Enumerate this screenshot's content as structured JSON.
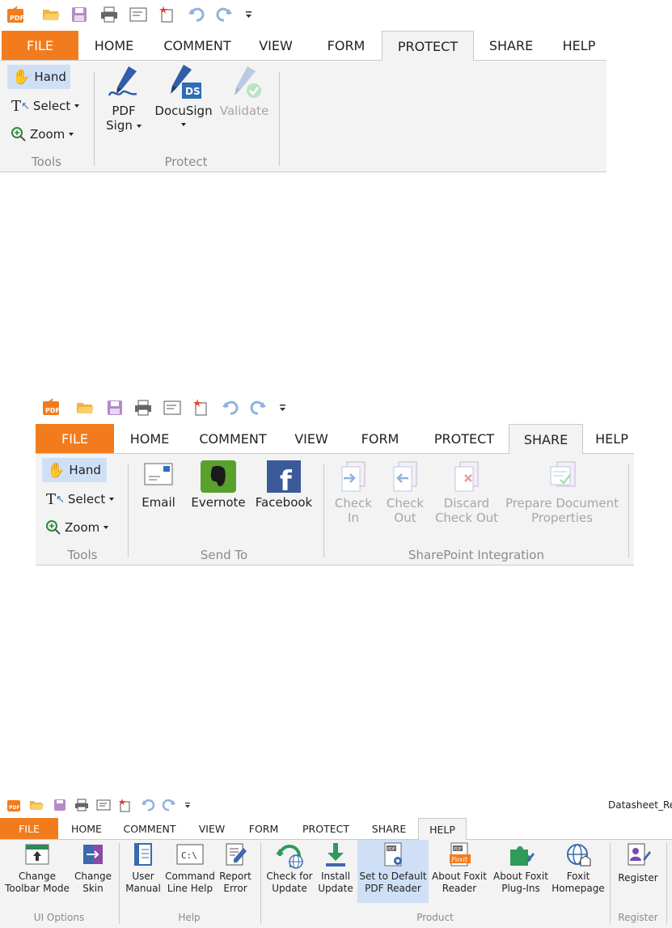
{
  "colors": {
    "file_tab": "#f27c1d",
    "selected_bg": "#cfe0f6",
    "disabled_text": "#a6a6a6",
    "ribbon_bg": "#f3f3f3",
    "group_label": "#8a8a8a"
  },
  "qat_icons": [
    "foxit-logo-icon",
    "open-folder-icon",
    "save-icon",
    "print-icon",
    "properties-icon",
    "new-icon",
    "undo-icon",
    "redo-icon",
    "customize-dropdown-icon"
  ],
  "tabs": {
    "file": "FILE",
    "home": "HOME",
    "comment": "COMMENT",
    "view": "VIEW",
    "form": "FORM",
    "protect": "PROTECT",
    "share": "SHARE",
    "help": "HELP"
  },
  "tools": {
    "hand": "Hand",
    "select": "Select",
    "zoom": "Zoom",
    "group": "Tools"
  },
  "protect_ribbon": {
    "pdf_sign_line1": "PDF",
    "pdf_sign_line2": "Sign",
    "docusign": "DocuSign",
    "validate": "Validate",
    "group": "Protect"
  },
  "share_ribbon": {
    "email": "Email",
    "evernote": "Evernote",
    "facebook": "Facebook",
    "send_to_group": "Send To",
    "check_in_1": "Check",
    "check_in_2": "In",
    "check_out_1": "Check",
    "check_out_2": "Out",
    "discard_1": "Discard",
    "discard_2": "Check Out",
    "prepare_1": "Prepare Document",
    "prepare_2": "Properties",
    "sharepoint_group": "SharePoint Integration"
  },
  "help_ribbon": {
    "window_title": "Datasheet_Re",
    "change_toolbar_1": "Change",
    "change_toolbar_2": "Toolbar Mode",
    "change_skin_1": "Change",
    "change_skin_2": "Skin",
    "ui_group": "UI Options",
    "user_manual_1": "User",
    "user_manual_2": "Manual",
    "cmd_help_1": "Command",
    "cmd_help_2": "Line Help",
    "report_error_1": "Report",
    "report_error_2": "Error",
    "help_group": "Help",
    "check_update_1": "Check for",
    "check_update_2": "Update",
    "install_update_1": "Install",
    "install_update_2": "Update",
    "set_default_1": "Set to Default",
    "set_default_2": "PDF Reader",
    "about_foxit_1": "About Foxit",
    "about_foxit_2": "Reader",
    "about_plugins_1": "About Foxit",
    "about_plugins_2": "Plug-Ins",
    "homepage_1": "Foxit",
    "homepage_2": "Homepage",
    "product_group": "Product",
    "register": "Register",
    "register_group": "Register",
    "cmd_icon_text": "C:\\"
  }
}
